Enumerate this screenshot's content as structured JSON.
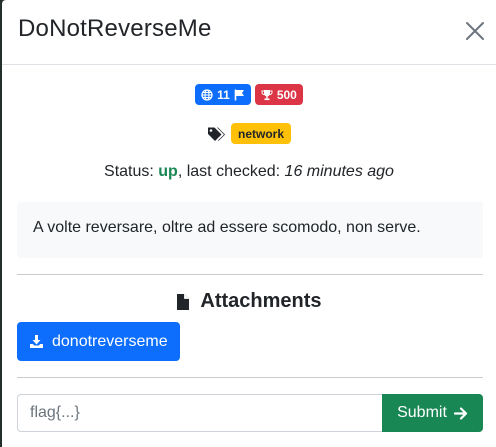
{
  "modal": {
    "title": "DoNotReverseMe",
    "solves": "11",
    "points": "500",
    "tags": [
      "network"
    ],
    "status": {
      "prefix": "Status: ",
      "state": "up",
      "middle": ", last checked: ",
      "time": "16 minutes ago"
    },
    "description": "A volte reversare, oltre ad essere scomodo, non serve.",
    "attachments_title": "Attachments",
    "attachment_label": "donotreverseme",
    "flag_placeholder": "flag{...}",
    "submit_label": "Submit"
  },
  "colors": {
    "primary": "#0d6efd",
    "danger": "#dc3545",
    "warning": "#ffc107",
    "success": "#198754"
  },
  "icons": [
    "close-icon",
    "globe-icon",
    "flag-icon",
    "trophy-icon",
    "tags-icon",
    "file-icon",
    "download-icon",
    "arrow-right-icon"
  ]
}
